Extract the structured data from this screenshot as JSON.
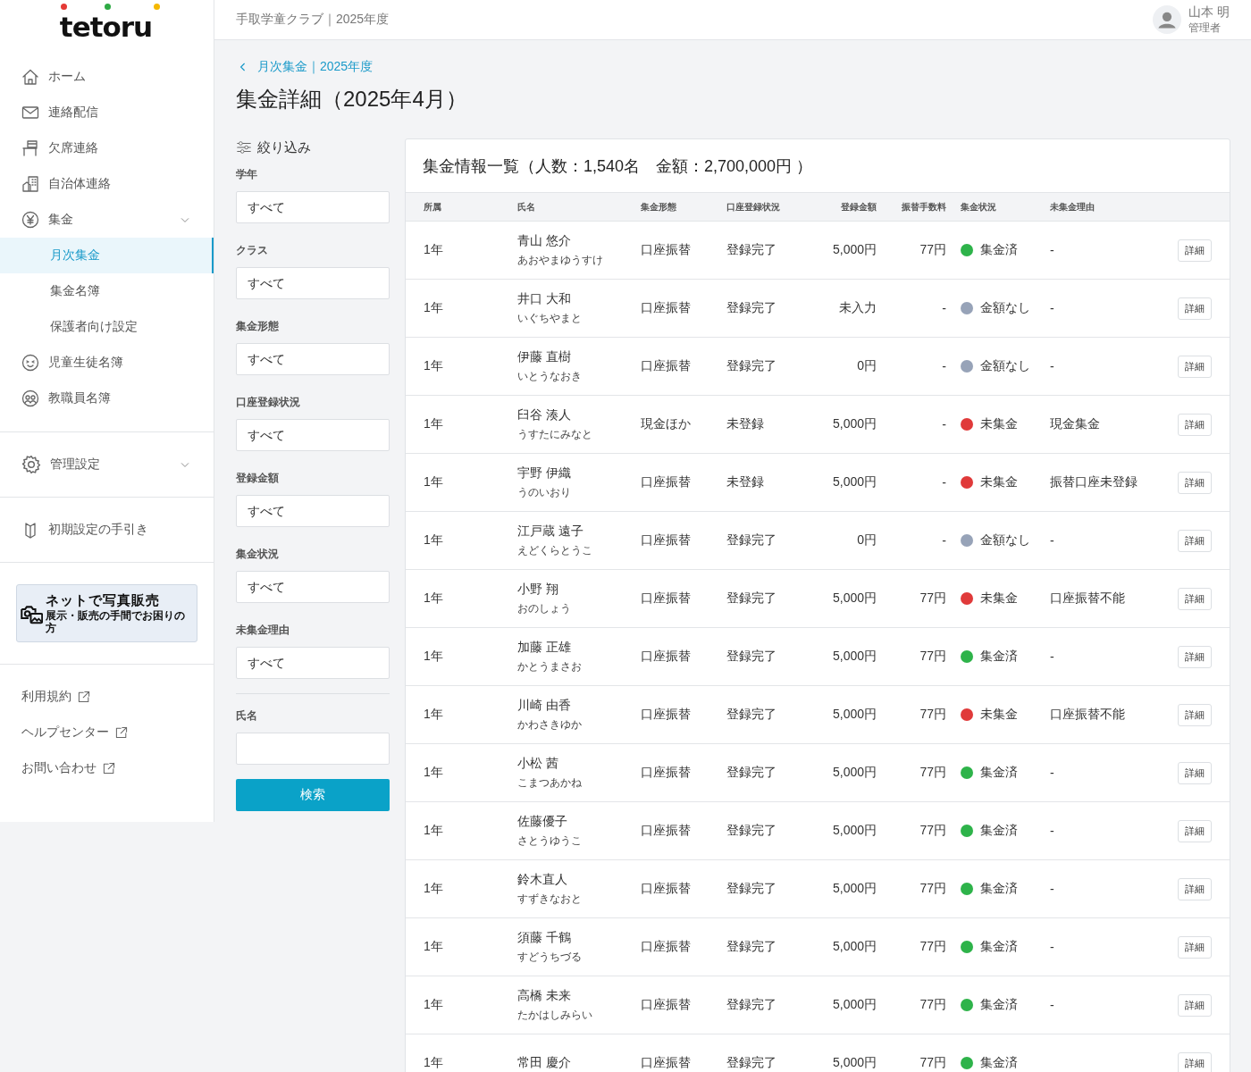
{
  "logo": {
    "text": "tetoru"
  },
  "sidebar": {
    "items": [
      {
        "label": "ホーム",
        "selected": false
      },
      {
        "label": "連絡配信",
        "selected": false
      },
      {
        "label": "欠席連絡",
        "selected": false
      },
      {
        "label": "自治体連絡",
        "selected": false
      },
      {
        "label": "集金",
        "selected": false,
        "expandable": true,
        "children": [
          {
            "label": "月次集金",
            "selected": true
          },
          {
            "label": "集金名簿",
            "selected": false
          },
          {
            "label": "保護者向け設定",
            "selected": false
          }
        ]
      },
      {
        "label": "児童生徒名簿",
        "selected": false
      },
      {
        "label": "教職員名簿",
        "selected": false
      }
    ],
    "settings": {
      "label": "管理設定",
      "expandable": true
    },
    "guide": {
      "label": "初期設定の手引き"
    },
    "banner": {
      "title": "ネットで写真販売",
      "subtitle": "展示・販売の手間でお困りの方"
    },
    "links": [
      "利用規約",
      "ヘルプセンター",
      "お問い合わせ"
    ]
  },
  "header": {
    "org": "手取学童クラブ｜2025年度",
    "user_name": "山本 明",
    "user_role": "管理者"
  },
  "breadcrumb": "月次集金｜2025年度",
  "page_title": "集金詳細（2025年4月）",
  "filters": {
    "title": "絞り込み",
    "selects": [
      {
        "label": "学年",
        "value": "すべて"
      },
      {
        "label": "クラス",
        "value": "すべて"
      },
      {
        "label": "集金形態",
        "value": "すべて"
      },
      {
        "label": "口座登録状況",
        "value": "すべて"
      },
      {
        "label": "登録金額",
        "value": "すべて"
      },
      {
        "label": "集金状況",
        "value": "すべて"
      },
      {
        "label": "未集金理由",
        "value": "すべて"
      }
    ],
    "name_field": {
      "label": "氏名"
    },
    "search_button": "検索"
  },
  "table": {
    "title": "集金情報一覧（人数：1,540名　金額：2,700,000円 ）",
    "columns": [
      "所属",
      "氏名",
      "集金形態",
      "口座登録状況",
      "登録金額",
      "振替手数料",
      "集金状況",
      "未集金理由"
    ],
    "rows": [
      {
        "grade": "1年",
        "name": "青山 悠介",
        "kana": "あおやまゆうすけ",
        "method": "口座振替",
        "account": "登録完了",
        "amount": "5,000円",
        "fee": "77円",
        "status": "集金済",
        "color": "#2eb34a",
        "reason": "-",
        "action": "詳細"
      },
      {
        "grade": "1年",
        "name": "井口 大和",
        "kana": "いぐちやまと",
        "method": "口座振替",
        "account": "登録完了",
        "amount": "未入力",
        "fee": "-",
        "status": "金額なし",
        "color": "#97a3b8",
        "reason": "-",
        "action": "詳細"
      },
      {
        "grade": "1年",
        "name": "伊藤 直樹",
        "kana": "いとうなおき",
        "method": "口座振替",
        "account": "登録完了",
        "amount": "0円",
        "fee": "-",
        "status": "金額なし",
        "color": "#97a3b8",
        "reason": "-",
        "action": "詳細"
      },
      {
        "grade": "1年",
        "name": "臼谷 湊人",
        "kana": "うすたにみなと",
        "method": "現金ほか",
        "account": "未登録",
        "amount": "5,000円",
        "fee": "-",
        "status": "未集金",
        "color": "#e03a3a",
        "reason": "現金集金",
        "action": "詳細"
      },
      {
        "grade": "1年",
        "name": "宇野 伊織",
        "kana": "うのいおり",
        "method": "口座振替",
        "account": "未登録",
        "amount": "5,000円",
        "fee": "-",
        "status": "未集金",
        "color": "#e03a3a",
        "reason": "振替口座未登録",
        "action": "詳細"
      },
      {
        "grade": "1年",
        "name": "江戸蔵 遠子",
        "kana": "えどくらとうこ",
        "method": "口座振替",
        "account": "登録完了",
        "amount": "0円",
        "fee": "-",
        "status": "金額なし",
        "color": "#97a3b8",
        "reason": "-",
        "action": "詳細"
      },
      {
        "grade": "1年",
        "name": "小野 翔",
        "kana": "おのしょう",
        "method": "口座振替",
        "account": "登録完了",
        "amount": "5,000円",
        "fee": "77円",
        "status": "未集金",
        "color": "#e03a3a",
        "reason": "口座振替不能",
        "action": "詳細"
      },
      {
        "grade": "1年",
        "name": "加藤 正雄",
        "kana": "かとうまさお",
        "method": "口座振替",
        "account": "登録完了",
        "amount": "5,000円",
        "fee": "77円",
        "status": "集金済",
        "color": "#2eb34a",
        "reason": "-",
        "action": "詳細"
      },
      {
        "grade": "1年",
        "name": "川崎 由香",
        "kana": "かわさきゆか",
        "method": "口座振替",
        "account": "登録完了",
        "amount": "5,000円",
        "fee": "77円",
        "status": "未集金",
        "color": "#e03a3a",
        "reason": "口座振替不能",
        "action": "詳細"
      },
      {
        "grade": "1年",
        "name": "小松 茜",
        "kana": "こまつあかね",
        "method": "口座振替",
        "account": "登録完了",
        "amount": "5,000円",
        "fee": "77円",
        "status": "集金済",
        "color": "#2eb34a",
        "reason": "-",
        "action": "詳細"
      },
      {
        "grade": "1年",
        "name": "佐藤優子",
        "kana": "さとうゆうこ",
        "method": "口座振替",
        "account": "登録完了",
        "amount": "5,000円",
        "fee": "77円",
        "status": "集金済",
        "color": "#2eb34a",
        "reason": "-",
        "action": "詳細"
      },
      {
        "grade": "1年",
        "name": "鈴木直人",
        "kana": "すずきなおと",
        "method": "口座振替",
        "account": "登録完了",
        "amount": "5,000円",
        "fee": "77円",
        "status": "集金済",
        "color": "#2eb34a",
        "reason": "-",
        "action": "詳細"
      },
      {
        "grade": "1年",
        "name": "須藤 千鶴",
        "kana": "すどうちづる",
        "method": "口座振替",
        "account": "登録完了",
        "amount": "5,000円",
        "fee": "77円",
        "status": "集金済",
        "color": "#2eb34a",
        "reason": "-",
        "action": "詳細"
      },
      {
        "grade": "1年",
        "name": "高橋 未来",
        "kana": "たかはしみらい",
        "method": "口座振替",
        "account": "登録完了",
        "amount": "5,000円",
        "fee": "77円",
        "status": "集金済",
        "color": "#2eb34a",
        "reason": "-",
        "action": "詳細"
      },
      {
        "grade": "1年",
        "name": "常田 慶介",
        "method": "口座振替",
        "account": "登録完了",
        "amount": "5,000円",
        "fee": "77円",
        "status": "集金済",
        "color": "#2eb34a",
        "action": "詳細"
      }
    ]
  }
}
